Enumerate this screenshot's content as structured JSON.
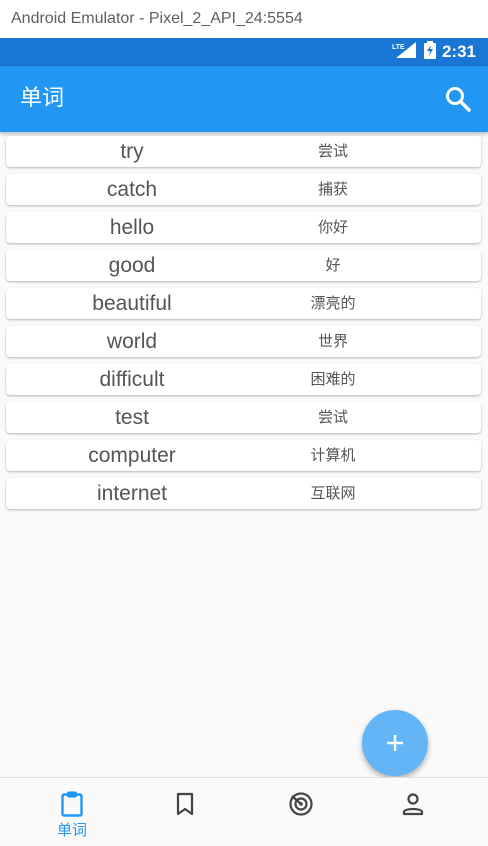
{
  "window": {
    "title": "Android Emulator - Pixel_2_API_24:5554"
  },
  "status_bar": {
    "network": "LTE",
    "time": "2:31"
  },
  "app_bar": {
    "title": "单词",
    "search_icon": "search-icon"
  },
  "words": [
    {
      "word": "try",
      "meaning": "尝试"
    },
    {
      "word": "catch",
      "meaning": "捕获"
    },
    {
      "word": "hello",
      "meaning": "你好"
    },
    {
      "word": "good",
      "meaning": "好"
    },
    {
      "word": "beautiful",
      "meaning": "漂亮的"
    },
    {
      "word": "world",
      "meaning": "世界"
    },
    {
      "word": "difficult",
      "meaning": "困难的"
    },
    {
      "word": "test",
      "meaning": "尝试"
    },
    {
      "word": "computer",
      "meaning": "计算机"
    },
    {
      "word": "internet",
      "meaning": "互联网"
    }
  ],
  "fab": {
    "icon": "plus-icon"
  },
  "bottom_nav": {
    "items": [
      {
        "icon": "clipboard-icon",
        "label": "单词",
        "active": true
      },
      {
        "icon": "bookmark-icon",
        "label": "",
        "active": false
      },
      {
        "icon": "radar-icon",
        "label": "",
        "active": false
      },
      {
        "icon": "person-icon",
        "label": "",
        "active": false
      }
    ]
  },
  "colors": {
    "primary": "#2196f3",
    "status_bar": "#1976d2",
    "fab": "#64b5f6",
    "active_nav": "#2196f3",
    "inactive_nav": "#444444"
  }
}
